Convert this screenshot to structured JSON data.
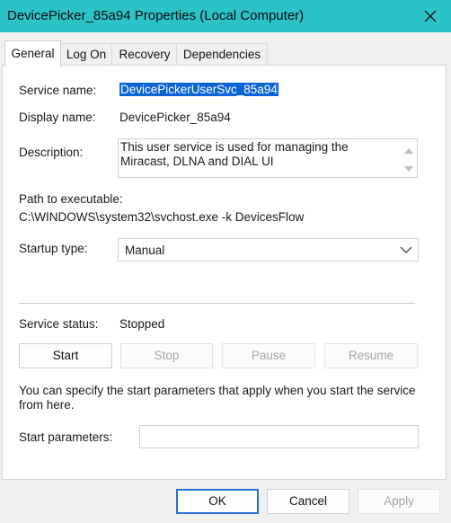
{
  "window": {
    "title": "DevicePicker_85a94 Properties (Local Computer)"
  },
  "tabs": [
    {
      "label": "General",
      "active": true
    },
    {
      "label": "Log On",
      "active": false
    },
    {
      "label": "Recovery",
      "active": false
    },
    {
      "label": "Dependencies",
      "active": false
    }
  ],
  "general": {
    "service_name_label": "Service name:",
    "service_name_value": "DevicePickerUserSvc_85a94",
    "display_name_label": "Display name:",
    "display_name_value": "DevicePicker_85a94",
    "description_label": "Description:",
    "description_value": "This user service is used for managing the Miracast, DLNA and DIAL UI",
    "path_label": "Path to executable:",
    "path_value": "C:\\WINDOWS\\system32\\svchost.exe -k DevicesFlow",
    "startup_type_label": "Startup type:",
    "startup_type_value": "Manual",
    "service_status_label": "Service status:",
    "service_status_value": "Stopped",
    "buttons": {
      "start": "Start",
      "stop": "Stop",
      "pause": "Pause",
      "resume": "Resume"
    },
    "info_text": "You can specify the start parameters that apply when you start the service from here.",
    "start_params_label": "Start parameters:",
    "start_params_value": ""
  },
  "footer": {
    "ok": "OK",
    "cancel": "Cancel",
    "apply": "Apply"
  },
  "colors": {
    "titlebar": "#2bc3c8",
    "selection": "#0a64d4",
    "default_button_border": "#2a6fd6"
  }
}
